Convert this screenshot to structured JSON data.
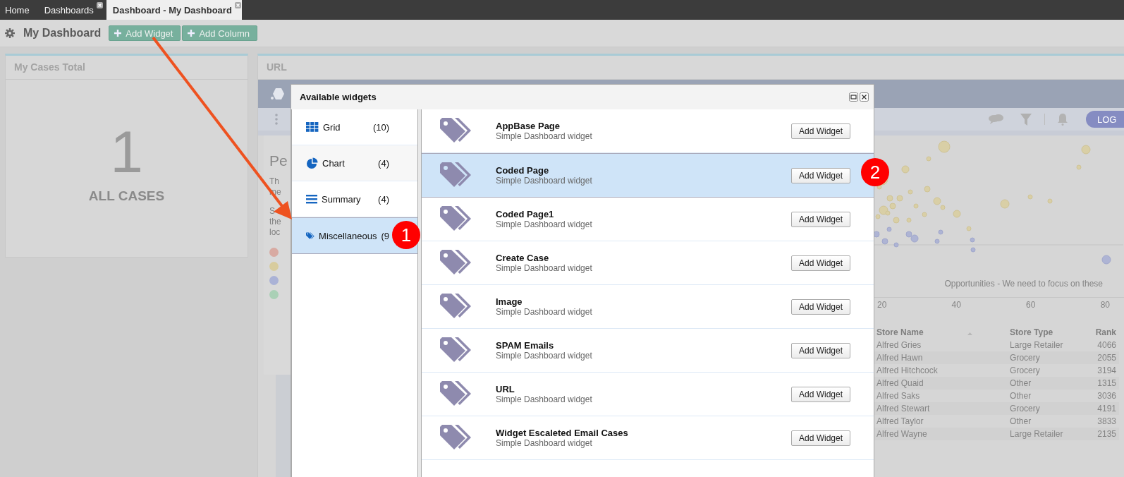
{
  "tabs": [
    {
      "label": "Home",
      "selected": false,
      "closable": false
    },
    {
      "label": "Dashboards",
      "selected": false,
      "closable": true
    },
    {
      "label": "Dashboard - My Dashboard",
      "selected": true,
      "closable": true
    }
  ],
  "toolbar": {
    "title": "My Dashboard",
    "buttons": [
      "Add Widget",
      "Add Column"
    ]
  },
  "cases_panel": {
    "title": "My Cases Total",
    "value": "1",
    "caption": "ALL CASES"
  },
  "url_panel": {
    "title": "URL",
    "log_button": "LOG",
    "heading": "Pe",
    "lines_1": [
      "Th",
      "me"
    ],
    "lines_2": [
      "S",
      "the",
      "loc"
    ],
    "legend": [
      {
        "color": "#d8aaa2"
      },
      {
        "color": "#d8cc9e"
      },
      {
        "color": "#aab2d6"
      },
      {
        "color": "#aad0b6"
      }
    ],
    "chart_caption": "Opportunities - We need to focus on these",
    "x_ticks": [
      "20",
      "40",
      "60",
      "80"
    ],
    "table": {
      "columns": [
        "Store Name",
        "Store Type",
        "Rank"
      ],
      "rows": [
        [
          "Alfred Gries",
          "Large Retailer",
          "4066"
        ],
        [
          "Alfred Hawn",
          "Grocery",
          "2055"
        ],
        [
          "Alfred Hitchcock",
          "Grocery",
          "3194"
        ],
        [
          "Alfred Quaid",
          "Other",
          "1315"
        ],
        [
          "Alfred Saks",
          "Other",
          "3036"
        ],
        [
          "Alfred Stewart",
          "Grocery",
          "4191"
        ],
        [
          "Alfred Taylor",
          "Other",
          "3833"
        ],
        [
          "Alfred Wayne",
          "Large Retailer",
          "2135"
        ]
      ]
    }
  },
  "dialog": {
    "title": "Available widgets",
    "categories": [
      {
        "kind": "grid",
        "label": "Grid",
        "count": "(10)",
        "selected": false
      },
      {
        "kind": "chart",
        "label": "Chart",
        "count": "(4)",
        "selected": false
      },
      {
        "kind": "summary",
        "label": "Summary",
        "count": "(4)",
        "selected": false
      },
      {
        "kind": "tag",
        "label": "Miscellaneous",
        "count": "(9",
        "selected": true
      }
    ],
    "widgets": [
      {
        "title": "AppBase Page",
        "subtitle": "Simple Dashboard widget",
        "button": "Add Widget",
        "selected": false
      },
      {
        "title": "Coded Page",
        "subtitle": "Simple Dashboard widget",
        "button": "Add Widget",
        "selected": true
      },
      {
        "title": "Coded Page1",
        "subtitle": "Simple Dashboard widget",
        "button": "Add Widget",
        "selected": false
      },
      {
        "title": "Create Case",
        "subtitle": "Simple Dashboard widget",
        "button": "Add Widget",
        "selected": false
      },
      {
        "title": "Image",
        "subtitle": "Simple Dashboard widget",
        "button": "Add Widget",
        "selected": false
      },
      {
        "title": "SPAM Emails",
        "subtitle": "Simple Dashboard widget",
        "button": "Add Widget",
        "selected": false
      },
      {
        "title": "URL",
        "subtitle": "Simple Dashboard widget",
        "button": "Add Widget",
        "selected": false
      },
      {
        "title": "Widget Escaleted Email Cases",
        "subtitle": "Simple Dashboard widget",
        "button": "Add Widget",
        "selected": false
      }
    ]
  },
  "badges": [
    "1",
    "2"
  ]
}
